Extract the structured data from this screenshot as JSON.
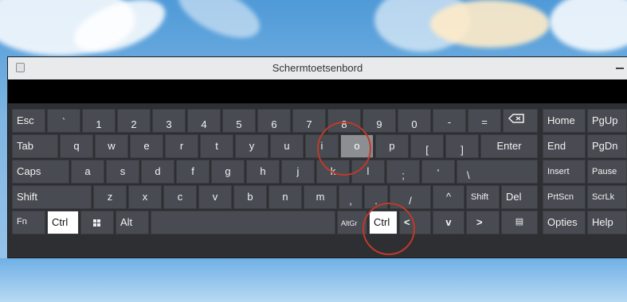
{
  "window": {
    "title": "Schermtoetsenbord"
  },
  "keys": {
    "esc": "Esc",
    "backtick": "`",
    "backtick_shift": "~",
    "n1": "1",
    "n2": "2",
    "n3": "3",
    "n4": "4",
    "n5": "5",
    "n6": "6",
    "n7": "7",
    "n8": "8",
    "n9": "9",
    "n0": "0",
    "minus": "-",
    "equal": "=",
    "tab": "Tab",
    "q": "q",
    "w": "w",
    "e": "e",
    "r": "r",
    "t": "t",
    "y": "y",
    "u": "u",
    "i": "i",
    "o": "o",
    "p": "p",
    "lbracket": "[",
    "rbracket": "]",
    "enter": "Enter",
    "caps": "Caps",
    "a": "a",
    "s": "s",
    "d": "d",
    "f": "f",
    "g": "g",
    "h": "h",
    "j": "j",
    "k": "k",
    "l": "l",
    "semicolon": ";",
    "quote": "'",
    "backslash": "\\",
    "shift": "Shift",
    "z": "z",
    "x": "x",
    "c": "c",
    "v": "v",
    "b": "b",
    "n": "n",
    "m": "m",
    "comma": ",",
    "period": ".",
    "slash": "/",
    "up": "^",
    "shift_r": "Shift",
    "del": "Del",
    "fn": "Fn",
    "ctrl": "Ctrl",
    "alt": "Alt",
    "altgr": "AltGr",
    "ctrl_r": "Ctrl",
    "left": "<",
    "down": "v",
    "right": ">",
    "menu_glyph": "▤",
    "home": "Home",
    "pgup": "PgUp",
    "end": "End",
    "pgdn": "PgDn",
    "insert": "Insert",
    "pause": "Pause",
    "prtscn": "PrtScn",
    "scrlk": "ScrLk",
    "opties": "Opties",
    "help": "Help"
  },
  "state": {
    "active_keys": [
      "ctrl",
      "ctrl_r"
    ],
    "pressed_keys": [
      "o"
    ]
  },
  "colors": {
    "key": "#484b51",
    "active": "#ffffff",
    "pressed": "#8c8e92",
    "highlight_circle": "#c0392b"
  }
}
